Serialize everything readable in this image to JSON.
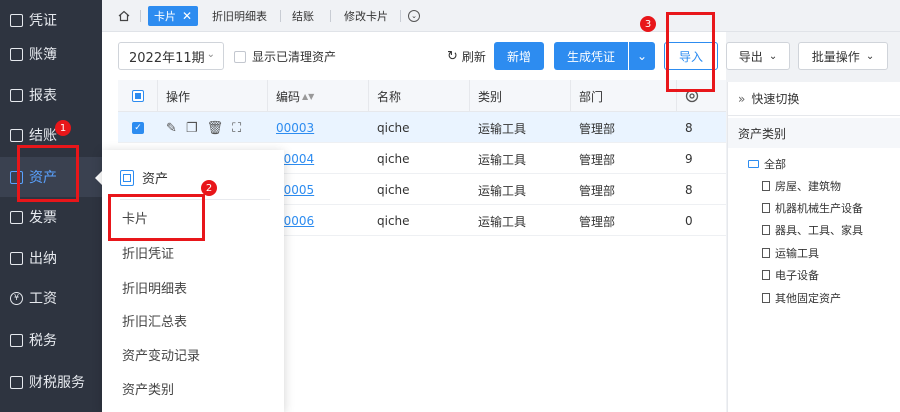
{
  "sidebar": {
    "items": [
      {
        "label": "凭证",
        "icon": "voucher-icon"
      },
      {
        "label": "账簿",
        "icon": "ledger-icon"
      },
      {
        "label": "报表",
        "icon": "report-icon"
      },
      {
        "label": "结账",
        "icon": "closing-icon"
      },
      {
        "label": "资产",
        "icon": "asset-icon",
        "active": true
      },
      {
        "label": "发票",
        "icon": "invoice-icon"
      },
      {
        "label": "出纳",
        "icon": "cashier-icon"
      },
      {
        "label": "工资",
        "icon": "salary-icon",
        "glyph": "¥"
      },
      {
        "label": "税务",
        "icon": "tax-icon"
      },
      {
        "label": "财税服务",
        "icon": "finance-service-icon"
      }
    ]
  },
  "tabs": [
    {
      "label": "卡片",
      "active": true,
      "close": "✕"
    },
    {
      "label": "折旧明细表"
    },
    {
      "label": "结账"
    },
    {
      "label": "修改卡片"
    }
  ],
  "toolbar": {
    "date_value": "2022年11期",
    "show_cleared_label": "显示已清理资产",
    "refresh_label": "刷新",
    "add_label": "新增",
    "generate_voucher_label": "生成凭证",
    "import_label": "导入",
    "export_label": "导出",
    "batch_label": "批量操作"
  },
  "table": {
    "columns": [
      "操作",
      "编码",
      "名称",
      "类别",
      "部门"
    ],
    "rows": [
      {
        "code": "00003",
        "name": "qiche",
        "category": "运输工具",
        "dept": "管理部",
        "extra": "8",
        "checked": true
      },
      {
        "code": "00004",
        "name": "qiche",
        "category": "运输工具",
        "dept": "管理部",
        "extra": "9"
      },
      {
        "code": "00005",
        "name": "qiche",
        "category": "运输工具",
        "dept": "管理部",
        "extra": "8"
      },
      {
        "code": "00006",
        "name": "qiche",
        "category": "运输工具",
        "dept": "管理部",
        "extra": "0"
      }
    ]
  },
  "right_panel": {
    "quick_switch": "快速切换",
    "category_title": "资产类别",
    "tree_root": "全部",
    "tree_items": [
      "房屋、建筑物",
      "机器机械生产设备",
      "器具、工具、家具",
      "运输工具",
      "电子设备",
      "其他固定资产"
    ]
  },
  "popover": {
    "title": "资产",
    "items": [
      "卡片",
      "折旧凭证",
      "折旧明细表",
      "折旧汇总表",
      "资产变动记录",
      "资产类别"
    ]
  },
  "annotations": [
    "1",
    "2",
    "3"
  ],
  "colors": {
    "primary": "#2d8cf0",
    "sidebar": "#2e3440",
    "annotation": "#e8161a"
  }
}
